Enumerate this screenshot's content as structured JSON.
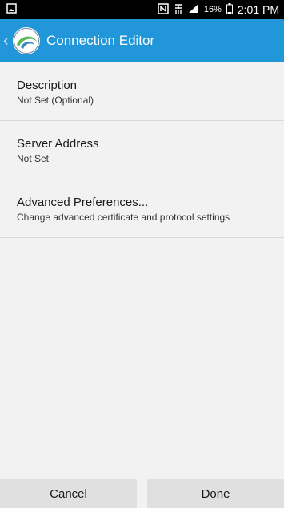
{
  "status_bar": {
    "battery_percent": "16%",
    "time": "2:01 PM",
    "icons": [
      "gallery-notification-icon",
      "nfc-icon",
      "network-icon",
      "signal-icon",
      "battery-icon"
    ]
  },
  "app_bar": {
    "title": "Connection Editor",
    "background": "#2196d8"
  },
  "items": [
    {
      "title": "Description",
      "subtitle": "Not Set (Optional)"
    },
    {
      "title": "Server Address",
      "subtitle": "Not Set"
    },
    {
      "title": "Advanced Preferences...",
      "subtitle": "Change advanced certificate and protocol settings"
    }
  ],
  "buttons": {
    "cancel": "Cancel",
    "done": "Done"
  }
}
